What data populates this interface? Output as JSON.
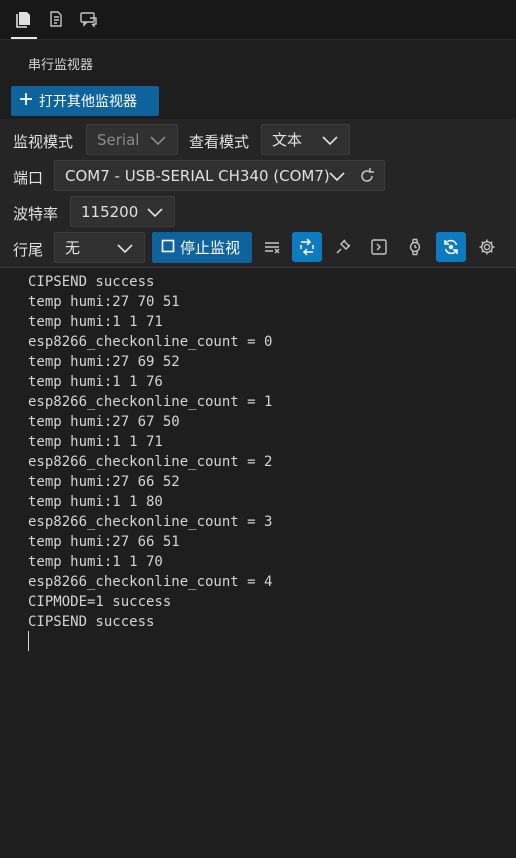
{
  "header": {
    "tabs": [
      {
        "icon": "files-icon",
        "active": true
      },
      {
        "icon": "notes-icon",
        "active": false
      },
      {
        "icon": "chat-icon",
        "active": false
      }
    ]
  },
  "section": {
    "title": "串行监视器",
    "open_other_label": "打开其他监视器"
  },
  "controls": {
    "monitor_mode_label": "监视模式",
    "monitor_mode_value": "Serial",
    "view_mode_label": "查看模式",
    "view_mode_value": "文本",
    "port_label": "端口",
    "port_value": "COM7 - USB-SERIAL CH340 (COM7)",
    "baud_label": "波特率",
    "baud_value": "115200",
    "line_ending_label": "行尾",
    "line_ending_value": "无",
    "stop_label": "停止监视"
  },
  "toolbar": {
    "accent": "#0e7ac0",
    "icons": [
      "clear-output-icon",
      "toggle-swap-icon",
      "connect-plug-icon",
      "terminal-icon",
      "timestamp-watch-icon",
      "autoscroll-icon",
      "settings-gear-icon"
    ]
  },
  "console": {
    "lines": [
      "CIPSEND success",
      "temp humi:27 70 51",
      "temp humi:1 1 71",
      "esp8266_checkonline_count = 0",
      "temp humi:27 69 52",
      "temp humi:1 1 76",
      "esp8266_checkonline_count = 1",
      "temp humi:27 67 50",
      "temp humi:1 1 71",
      "esp8266_checkonline_count = 2",
      "temp humi:27 66 52",
      "temp humi:1 1 80",
      "esp8266_checkonline_count = 3",
      "temp humi:27 66 51",
      "temp humi:1 1 70",
      "esp8266_checkonline_count = 4",
      "CIPMODE=1 success",
      "CIPSEND success"
    ]
  }
}
